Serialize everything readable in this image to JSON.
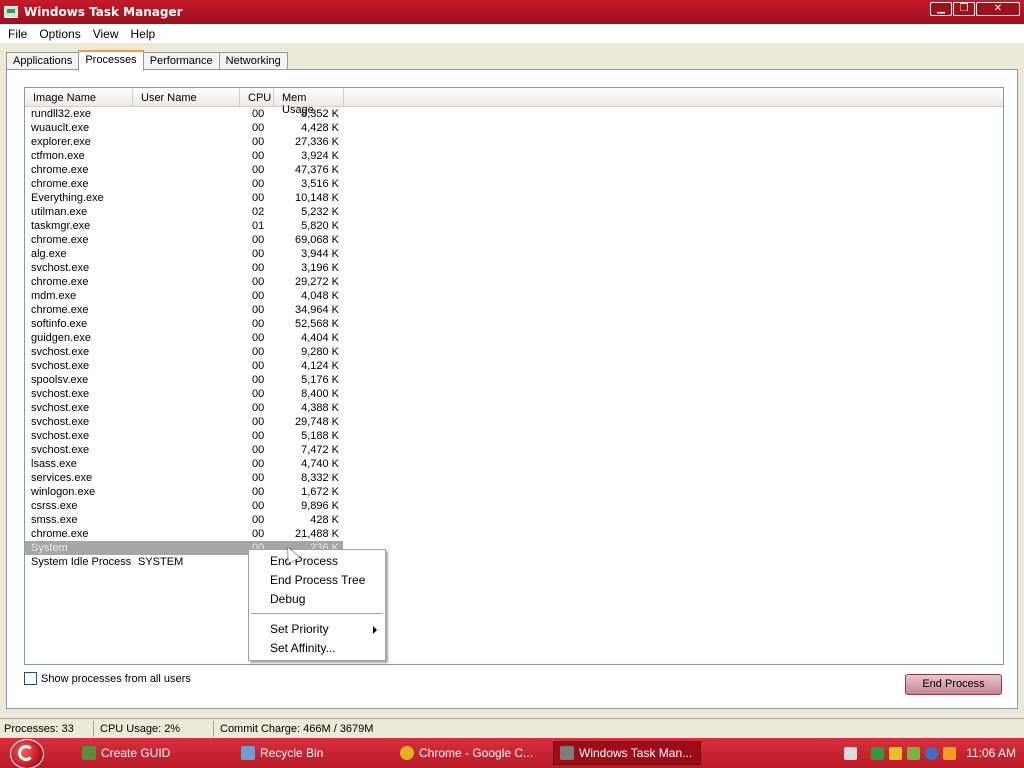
{
  "window": {
    "title": "Windows Task Manager"
  },
  "window_controls": {
    "minimize": "▁",
    "restore": "❐",
    "close": "✕"
  },
  "menu": [
    "File",
    "Options",
    "View",
    "Help"
  ],
  "tabs": [
    "Applications",
    "Processes",
    "Performance",
    "Networking"
  ],
  "active_tab": "Processes",
  "columns": {
    "name": "Image Name",
    "user": "User Name",
    "cpu": "CPU",
    "mem": "Mem Usage"
  },
  "processes": [
    {
      "name": "rundll32.exe",
      "user": "",
      "cpu": "00",
      "mem": "8,352 K"
    },
    {
      "name": "wuauclt.exe",
      "user": "",
      "cpu": "00",
      "mem": "4,428 K"
    },
    {
      "name": "explorer.exe",
      "user": "",
      "cpu": "00",
      "mem": "27,336 K"
    },
    {
      "name": "ctfmon.exe",
      "user": "",
      "cpu": "00",
      "mem": "3,924 K"
    },
    {
      "name": "chrome.exe",
      "user": "",
      "cpu": "00",
      "mem": "47,376 K"
    },
    {
      "name": "chrome.exe",
      "user": "",
      "cpu": "00",
      "mem": "3,516 K"
    },
    {
      "name": "Everything.exe",
      "user": "",
      "cpu": "00",
      "mem": "10,148 K"
    },
    {
      "name": "utilman.exe",
      "user": "",
      "cpu": "02",
      "mem": "5,232 K"
    },
    {
      "name": "taskmgr.exe",
      "user": "",
      "cpu": "01",
      "mem": "5,820 K"
    },
    {
      "name": "chrome.exe",
      "user": "",
      "cpu": "00",
      "mem": "69,068 K"
    },
    {
      "name": "alg.exe",
      "user": "",
      "cpu": "00",
      "mem": "3,944 K"
    },
    {
      "name": "svchost.exe",
      "user": "",
      "cpu": "00",
      "mem": "3,196 K"
    },
    {
      "name": "chrome.exe",
      "user": "",
      "cpu": "00",
      "mem": "29,272 K"
    },
    {
      "name": "mdm.exe",
      "user": "",
      "cpu": "00",
      "mem": "4,048 K"
    },
    {
      "name": "chrome.exe",
      "user": "",
      "cpu": "00",
      "mem": "34,964 K"
    },
    {
      "name": "softinfo.exe",
      "user": "",
      "cpu": "00",
      "mem": "52,568 K"
    },
    {
      "name": "guidgen.exe",
      "user": "",
      "cpu": "00",
      "mem": "4,404 K"
    },
    {
      "name": "svchost.exe",
      "user": "",
      "cpu": "00",
      "mem": "9,280 K"
    },
    {
      "name": "svchost.exe",
      "user": "",
      "cpu": "00",
      "mem": "4,124 K"
    },
    {
      "name": "spoolsv.exe",
      "user": "",
      "cpu": "00",
      "mem": "5,176 K"
    },
    {
      "name": "svchost.exe",
      "user": "",
      "cpu": "00",
      "mem": "8,400 K"
    },
    {
      "name": "svchost.exe",
      "user": "",
      "cpu": "00",
      "mem": "4,388 K"
    },
    {
      "name": "svchost.exe",
      "user": "",
      "cpu": "00",
      "mem": "29,748 K"
    },
    {
      "name": "svchost.exe",
      "user": "",
      "cpu": "00",
      "mem": "5,188 K"
    },
    {
      "name": "svchost.exe",
      "user": "",
      "cpu": "00",
      "mem": "7,472 K"
    },
    {
      "name": "lsass.exe",
      "user": "",
      "cpu": "00",
      "mem": "4,740 K"
    },
    {
      "name": "services.exe",
      "user": "",
      "cpu": "00",
      "mem": "8,332 K"
    },
    {
      "name": "winlogon.exe",
      "user": "",
      "cpu": "00",
      "mem": "1,672 K"
    },
    {
      "name": "csrss.exe",
      "user": "",
      "cpu": "00",
      "mem": "9,896 K"
    },
    {
      "name": "smss.exe",
      "user": "",
      "cpu": "00",
      "mem": "428 K"
    },
    {
      "name": "chrome.exe",
      "user": "",
      "cpu": "00",
      "mem": "21,488 K"
    },
    {
      "name": "System",
      "user": "",
      "cpu": "00",
      "mem": "236 K",
      "selected": true
    },
    {
      "name": "System Idle Process",
      "user": "SYSTEM",
      "cpu": "",
      "mem": ""
    }
  ],
  "context_menu": {
    "items": [
      "End Process",
      "End Process Tree",
      "Debug"
    ],
    "items2": [
      "Set Priority",
      "Set Affinity..."
    ]
  },
  "show_all_label": "Show processes from all users",
  "end_process_button": "End Process",
  "status": {
    "processes": "Processes: 33",
    "cpu": "CPU Usage: 2%",
    "commit": "Commit Charge: 466M / 3679M"
  },
  "taskbar": {
    "tasks": [
      {
        "label": "Create GUID",
        "icon": "calculator-icon",
        "color": "#5a8f3a"
      },
      {
        "label": "Recycle Bin",
        "icon": "recycle-bin-icon",
        "color": "#6c9ec9"
      },
      {
        "label": "Chrome - Google C...",
        "icon": "chrome-icon",
        "color": "#e3b11f"
      },
      {
        "label": "Windows Task Man...",
        "icon": "task-manager-icon",
        "color": "#7c7c7c"
      }
    ],
    "clock": "11:06 AM",
    "tray_icons": [
      {
        "name": "keyboard-icon",
        "color": "#dcdcdc"
      },
      {
        "name": "green-app-icon",
        "color": "#2f9b3a"
      },
      {
        "name": "shield-icon",
        "color": "#e8c02a"
      },
      {
        "name": "network-icon",
        "color": "#7cb342"
      },
      {
        "name": "search-tray-icon",
        "color": "#3a6fc7"
      },
      {
        "name": "key-icon",
        "color": "#f0a020"
      }
    ]
  },
  "colors": {
    "accent": "#c41a2a",
    "selection": "#a6a6a6"
  }
}
